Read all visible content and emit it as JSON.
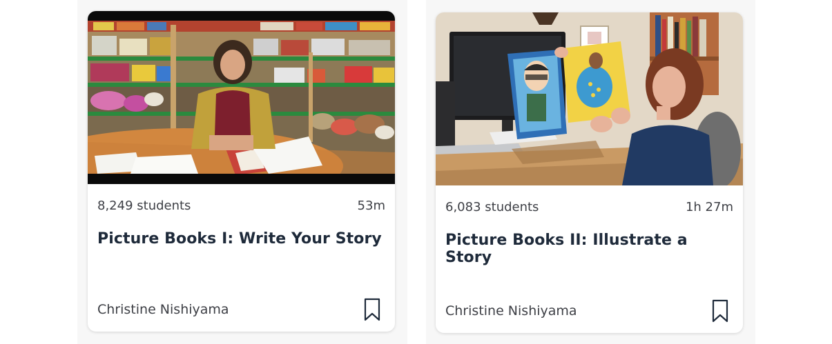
{
  "cards": [
    {
      "students": "8,249 students",
      "duration": "53m",
      "title": "Picture Books I: Write Your Story",
      "teacher": "Christine Nishiyama",
      "thumbnail_icon": "video-thumbnail-bookstore",
      "bookmark_icon": "bookmark-icon"
    },
    {
      "students": "6,083 students",
      "duration": "1h 27m",
      "title": "Picture Books II: Illustrate a Story",
      "teacher": "Christine Nishiyama",
      "thumbnail_icon": "video-thumbnail-studio",
      "bookmark_icon": "bookmark-icon"
    }
  ],
  "colors": {
    "title": "#1e2a3a",
    "meta_text": "#3d3f45",
    "card_bg": "#ffffff",
    "column_bg": "#f7f7f7"
  }
}
